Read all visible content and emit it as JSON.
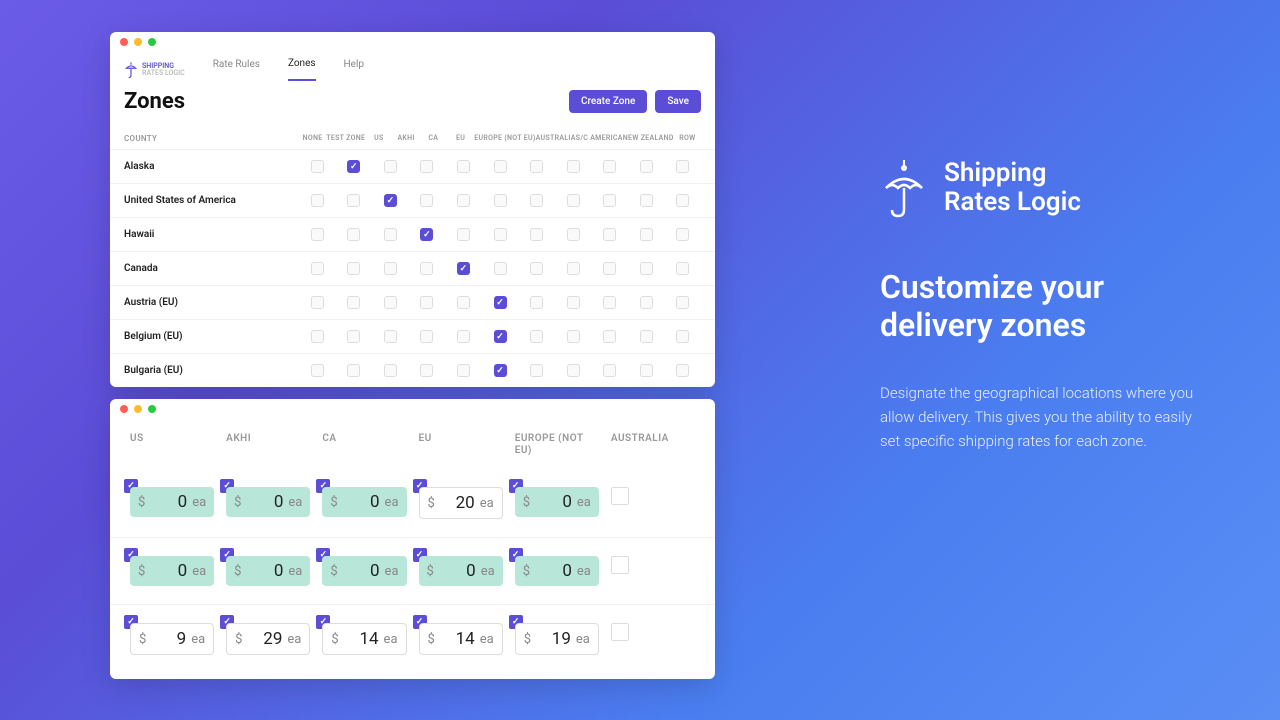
{
  "brand_line1": "Shipping",
  "brand_line2": "Rates Logic",
  "logo_line1": "SHIPPING",
  "logo_line2": "RATES LOGIC",
  "nav": {
    "rate_rules": "Rate Rules",
    "zones": "Zones",
    "help": "Help"
  },
  "page": {
    "title": "Zones",
    "create": "Create Zone",
    "save": "Save"
  },
  "zone_cols": [
    "COUNTY",
    "NONE",
    "TEST ZONE",
    "US",
    "AKHI",
    "CA",
    "EU",
    "EUROPE (NOT EU)",
    "AUSTRALIA",
    "S/C AMERICA",
    "NEW ZEALAND",
    "ROW"
  ],
  "rows": [
    {
      "name": "Alaska",
      "checked": 2
    },
    {
      "name": "United States of America",
      "checked": 3
    },
    {
      "name": "Hawaii",
      "checked": 4
    },
    {
      "name": "Canada",
      "checked": 5
    },
    {
      "name": "Austria (EU)",
      "checked": 6
    },
    {
      "name": "Belgium (EU)",
      "checked": 6
    },
    {
      "name": "Bulgaria (EU)",
      "checked": 6
    }
  ],
  "rate_cols": [
    "US",
    "AKHI",
    "CA",
    "EU",
    "EUROPE (NOT EU)",
    "AUSTRALIA"
  ],
  "rate_rows": [
    [
      {
        "v": "0",
        "g": 1
      },
      {
        "v": "0",
        "g": 1
      },
      {
        "v": "0",
        "g": 1
      },
      {
        "v": "20",
        "g": 0
      },
      {
        "v": "0",
        "g": 1
      },
      {
        "empty": 1
      }
    ],
    [
      {
        "v": "0",
        "g": 1
      },
      {
        "v": "0",
        "g": 1
      },
      {
        "v": "0",
        "g": 1
      },
      {
        "v": "0",
        "g": 1
      },
      {
        "v": "0",
        "g": 1
      },
      {
        "empty": 1
      }
    ],
    [
      {
        "v": "9",
        "g": 0
      },
      {
        "v": "29",
        "g": 0
      },
      {
        "v": "14",
        "g": 0
      },
      {
        "v": "14",
        "g": 0
      },
      {
        "v": "19",
        "g": 0
      },
      {
        "empty": 1
      }
    ]
  ],
  "currency": "$",
  "unit": "ea",
  "headline": "Customize your delivery zones",
  "desc": "Designate the geographical locations where you allow delivery. This gives you the ability to easily set specific shipping rates for each zone."
}
